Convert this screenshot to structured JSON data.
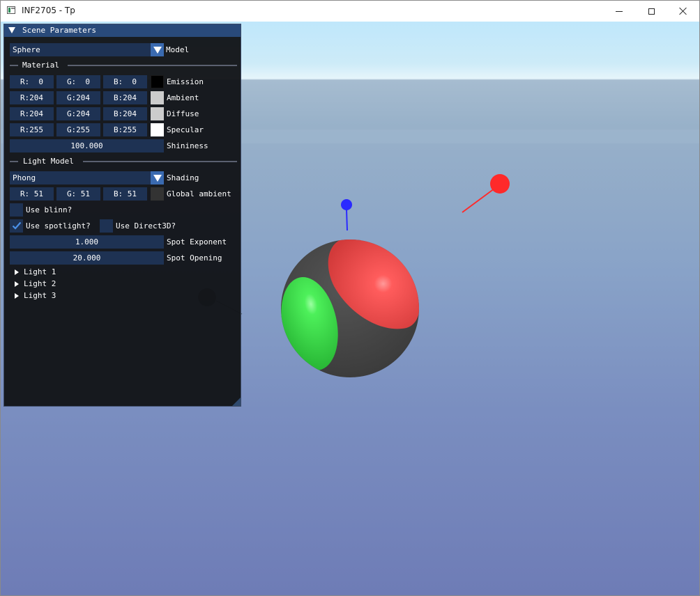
{
  "window": {
    "title": "INF2705 - Tp",
    "app_icon": "app-icon",
    "controls": [
      "minimize-icon",
      "maximize-icon",
      "close-icon"
    ]
  },
  "panel": {
    "title": "Scene Parameters",
    "model": {
      "value": "Sphere",
      "label": "Model"
    },
    "material_header": "Material",
    "emission": {
      "r": "R:  0",
      "g": "G:  0",
      "b": "B:  0",
      "label": "Emission",
      "color": "#000000"
    },
    "ambient": {
      "r": "R:204",
      "g": "G:204",
      "b": "B:204",
      "label": "Ambient",
      "color": "#cccccc"
    },
    "diffuse": {
      "r": "R:204",
      "g": "G:204",
      "b": "B:204",
      "label": "Diffuse",
      "color": "#cccccc"
    },
    "specular": {
      "r": "R:255",
      "g": "G:255",
      "b": "B:255",
      "label": "Specular",
      "color": "#ffffff"
    },
    "shininess": {
      "value": "100.000",
      "label": "Shininess"
    },
    "light_model_header": "Light Model",
    "shading": {
      "value": "Phong",
      "label": "Shading"
    },
    "global_ambient": {
      "r": "R: 51",
      "g": "G: 51",
      "b": "B: 51",
      "label": "Global ambient",
      "color": "#333333"
    },
    "use_blinn": {
      "label": "Use blinn?",
      "checked": false
    },
    "use_spotlight": {
      "label": "Use spotlight?",
      "checked": true
    },
    "use_direct3d": {
      "label": "Use Direct3D?",
      "checked": false
    },
    "spot_exponent": {
      "value": "1.000",
      "label": "Spot Exponent"
    },
    "spot_opening": {
      "value": "20.000",
      "label": "Spot Opening"
    },
    "lights": [
      "Light 1",
      "Light 2",
      "Light 3"
    ]
  },
  "scene": {
    "sky_color": "#cdebf8",
    "ground_color": "#8ba6cc",
    "sphere_base_color": "#444444",
    "spot_red_color": "#ff3a3a",
    "spot_green_color": "#33e43f",
    "light_red_color": "#ff2a2a",
    "light_blue_color": "#2a2aff"
  }
}
